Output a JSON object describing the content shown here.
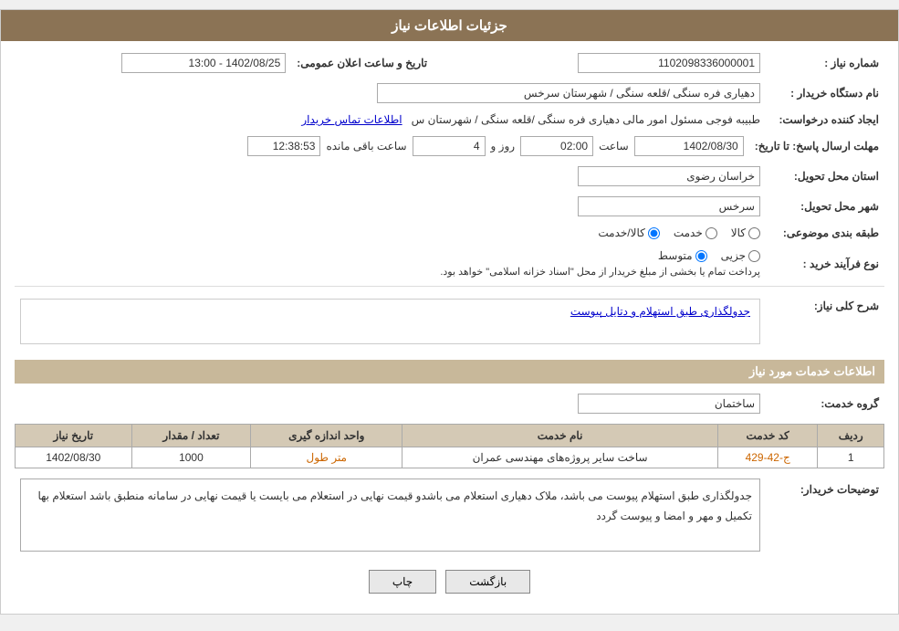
{
  "header": {
    "title": "جزئیات اطلاعات نیاز"
  },
  "fields": {
    "need_number_label": "شماره نیاز :",
    "need_number_value": "1102098336000001",
    "buyer_org_label": "نام دستگاه خریدار :",
    "buyer_org_value": "دهیاری فره سنگی /قلعه سنگی / شهرستان سرخس",
    "announcement_date_label": "تاریخ و ساعت اعلان عمومی:",
    "announcement_date_value": "1402/08/25 - 13:00",
    "creator_label": "ایجاد کننده درخواست:",
    "creator_value": "طبیبه فوجی مسئول امور مالی دهیاری فره سنگی /قلعه سنگی / شهرستان س",
    "contact_link": "اطلاعات تماس خریدار",
    "reply_deadline_label": "مهلت ارسال پاسخ: تا تاریخ:",
    "reply_date": "1402/08/30",
    "reply_time_label": "ساعت",
    "reply_time": "02:00",
    "reply_days_label": "روز و",
    "reply_days": "4",
    "reply_remaining_label": "ساعت باقی مانده",
    "reply_remaining": "12:38:53",
    "delivery_province_label": "استان محل تحویل:",
    "delivery_province_value": "خراسان رضوی",
    "delivery_city_label": "شهر محل تحویل:",
    "delivery_city_value": "سرخس",
    "category_label": "طبقه بندی موضوعی:",
    "category_kala": "کالا",
    "category_khadamat": "خدمت",
    "category_kala_khadamat": "کالا/خدمت",
    "purchase_type_label": "نوع فرآیند خرید :",
    "purchase_jozvi": "جزیی",
    "purchase_motavaset": "متوسط",
    "purchase_note": "پرداخت تمام یا بخشی از مبلغ خریدار از محل \"اسناد خزانه اسلامی\" خواهد بود.",
    "need_description_label": "شرح کلی نیاز:",
    "need_description_value": "جدولگذاری طبق استهلام و دتایل پیوست",
    "services_section_label": "اطلاعات خدمات مورد نیاز",
    "service_group_label": "گروه خدمت:",
    "service_group_value": "ساختمان",
    "table_headers": {
      "row_num": "ردیف",
      "service_code": "کد خدمت",
      "service_name": "نام خدمت",
      "measurement_unit": "واحد اندازه گیری",
      "count_amount": "تعداد / مقدار",
      "need_date": "تاریخ نیاز"
    },
    "table_rows": [
      {
        "row_num": "1",
        "service_code": "ج-42-429",
        "service_name": "ساخت سایر پروژه‌های مهندسی عمران",
        "measurement_unit": "متر طول",
        "count_amount": "1000",
        "need_date": "1402/08/30"
      }
    ],
    "buyer_description_label": "توضیحات خریدار:",
    "buyer_description_value": "جدولگذاری طبق استهلام  پیوست می باشد، ملاک  دهیاری استعلام  می باشدو قیمت نهایی در استعلام می بایست یا قیمت  نهایی در سامانه  منطبق باشد استعلام  بها  تکمیل  و مهر و امضا و پیوست  گردد"
  },
  "buttons": {
    "print_label": "چاپ",
    "back_label": "بازگشت"
  }
}
